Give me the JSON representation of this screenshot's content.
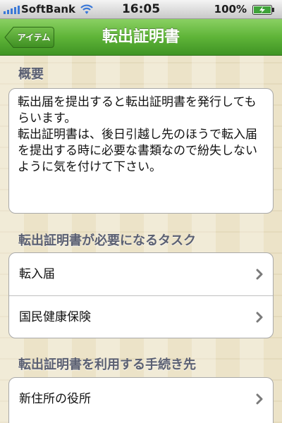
{
  "status_bar": {
    "carrier": "SoftBank",
    "time": "16:05",
    "battery_percent": "100%",
    "icons": {
      "signal": "signal-strength-icon",
      "wifi": "wifi-icon",
      "battery": "battery-charging-icon"
    }
  },
  "nav": {
    "back_label": "アイテム",
    "title": "転出証明書",
    "color": "#5fb438"
  },
  "sections": {
    "overview": {
      "header": "概要",
      "body": "転出届を提出すると転出証明書を発行してもらいます。\n転出証明書は、後日引越し先のほうで転入届を提出する時に必要な書類なので紛失しないように気を付けて下さい。"
    },
    "required_tasks": {
      "header": "転出証明書が必要になるタスク",
      "items": [
        {
          "label": "転入届"
        },
        {
          "label": "国民健康保険"
        }
      ]
    },
    "destinations": {
      "header": "転出証明書を利用する手続き先",
      "items": [
        {
          "label": "新住所の役所"
        }
      ]
    }
  }
}
